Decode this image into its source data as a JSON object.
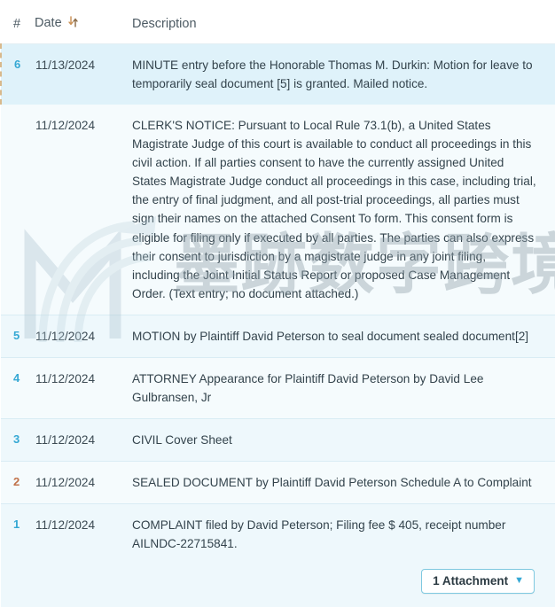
{
  "table": {
    "columns": [
      {
        "key": "num",
        "label": "#"
      },
      {
        "key": "date",
        "label": "Date",
        "sort_icon": "sort-updown-icon"
      },
      {
        "key": "desc",
        "label": "Description"
      }
    ],
    "rows": [
      {
        "num": "6",
        "date": "11/13/2024",
        "desc": "MINUTE entry before the Honorable Thomas M. Durkin: Motion for leave to temporarily seal document [5] is granted. Mailed notice.",
        "style": "highlight",
        "num_color": "#35a8d4"
      },
      {
        "num": "",
        "date": "11/12/2024",
        "desc": "CLERK'S NOTICE: Pursuant to Local Rule 73.1(b), a United States Magistrate Judge of this court is available to conduct all proceedings in this civil action. If all parties consent to have the currently assigned United States Magistrate Judge conduct all proceedings in this case, including trial, the entry of final judgment, and all post-trial proceedings, all parties must sign their names on the attached Consent To form. This consent form is eligible for filing only if executed by all parties. The parties can also express their consent to jurisdiction by a magistrate judge in any joint filing, including the Joint Initial Status Report or proposed Case Management Order. (Text entry; no document attached.)",
        "style": "plain",
        "num_color": ""
      },
      {
        "num": "5",
        "date": "11/12/2024",
        "desc": "MOTION by Plaintiff David Peterson to seal document sealed document[2]",
        "style": "alt",
        "num_color": "#35a8d4"
      },
      {
        "num": "4",
        "date": "11/12/2024",
        "desc": "ATTORNEY Appearance for Plaintiff David Peterson by David Lee Gulbransen, Jr",
        "style": "plain",
        "num_color": "#35a8d4"
      },
      {
        "num": "3",
        "date": "11/12/2024",
        "desc": "CIVIL Cover Sheet",
        "style": "alt",
        "num_color": "#35a8d4"
      },
      {
        "num": "2",
        "date": "11/12/2024",
        "desc": "SEALED DOCUMENT by Plaintiff David Peterson Schedule A to Complaint",
        "style": "plain",
        "num_color": "#c1724a"
      },
      {
        "num": "1",
        "date": "11/12/2024",
        "desc": "COMPLAINT filed by David Peterson; Filing fee $ 405, receipt number AILNDC-22715841.",
        "style": "alt",
        "num_color": "#35a8d4",
        "attachment_label": "1 Attachment",
        "attachment_caret": "▼"
      }
    ]
  },
  "watermark": {
    "text": "墨跡数字跨境",
    "logo": "m-monogram-logo"
  },
  "colors": {
    "accent_blue": "#35a8d4",
    "accent_orange": "#c1724a",
    "highlight_bg": "#dff2fa",
    "row_bg": "#f5fbfd",
    "row_alt_bg": "#eef8fc",
    "dashed_border": "#d8b98c"
  }
}
